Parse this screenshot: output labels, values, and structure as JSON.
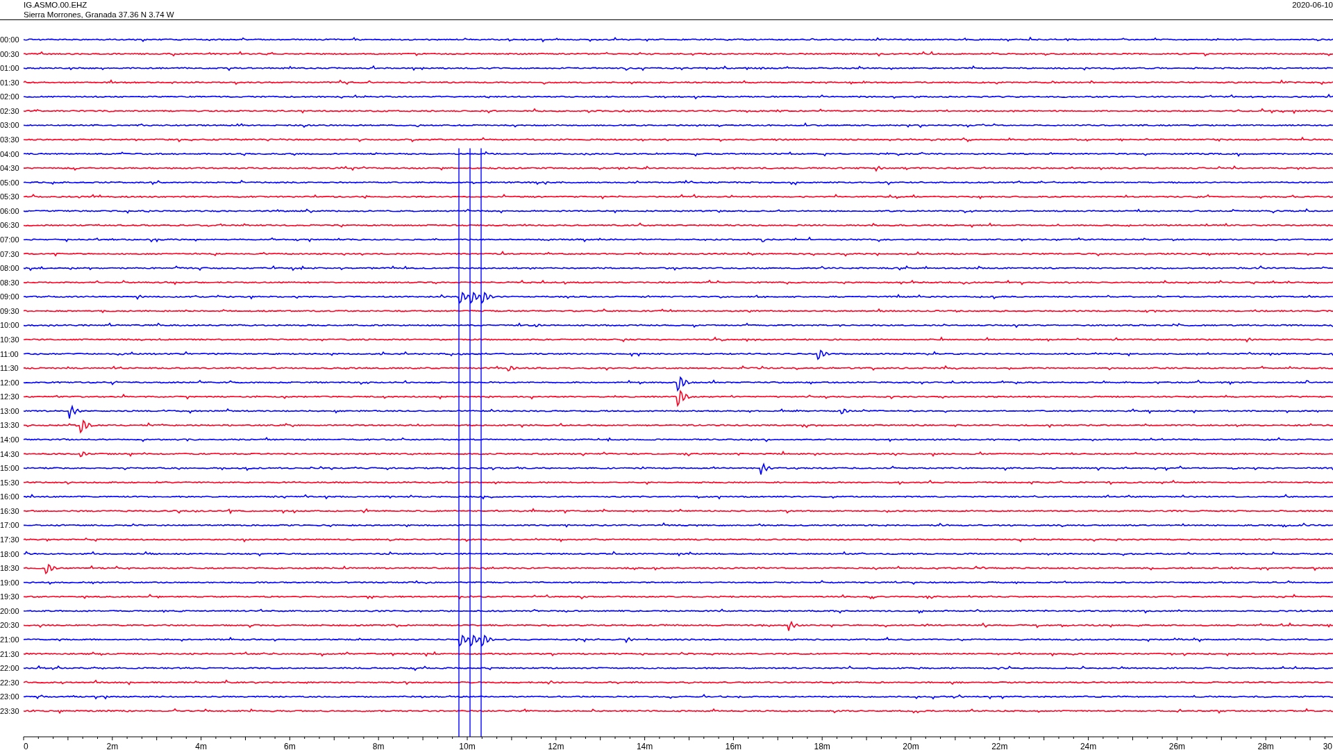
{
  "header": {
    "station": "IG.ASMO.00.EHZ",
    "location": "Sierra Morrones, Granada  37.36 N 3.74 W",
    "date": "2020-06-10"
  },
  "rows": [
    {
      "label": "00:00",
      "color": "#0000ff"
    },
    {
      "label": "00:30",
      "color": "#ff0022"
    },
    {
      "label": "01:00",
      "color": "#0000ff"
    },
    {
      "label": "01:30",
      "color": "#ff0022"
    },
    {
      "label": "02:00",
      "color": "#0000ff"
    },
    {
      "label": "02:30",
      "color": "#ff0022"
    },
    {
      "label": "03:00",
      "color": "#0000ff"
    },
    {
      "label": "03:30",
      "color": "#ff0022"
    },
    {
      "label": "04:00",
      "color": "#0000ff"
    },
    {
      "label": "04:30",
      "color": "#ff0022"
    },
    {
      "label": "05:00",
      "color": "#0000ff"
    },
    {
      "label": "05:30",
      "color": "#ff0022"
    },
    {
      "label": "06:00",
      "color": "#0000ff"
    },
    {
      "label": "06:30",
      "color": "#ff0022"
    },
    {
      "label": "07:00",
      "color": "#0000ff"
    },
    {
      "label": "07:30",
      "color": "#ff0022"
    },
    {
      "label": "08:00",
      "color": "#0000ff"
    },
    {
      "label": "08:30",
      "color": "#ff0022"
    },
    {
      "label": "09:00",
      "color": "#0000ff"
    },
    {
      "label": "09:30",
      "color": "#ff0022"
    },
    {
      "label": "10:00",
      "color": "#0000ff"
    },
    {
      "label": "10:30",
      "color": "#ff0022"
    },
    {
      "label": "11:00",
      "color": "#0000ff"
    },
    {
      "label": "11:30",
      "color": "#ff0022"
    },
    {
      "label": "12:00",
      "color": "#0000ff"
    },
    {
      "label": "12:30",
      "color": "#ff0022"
    },
    {
      "label": "13:00",
      "color": "#0000ff"
    },
    {
      "label": "13:30",
      "color": "#ff0022"
    },
    {
      "label": "14:00",
      "color": "#0000ff"
    },
    {
      "label": "14:30",
      "color": "#ff0022"
    },
    {
      "label": "15:00",
      "color": "#0000ff"
    },
    {
      "label": "15:30",
      "color": "#ff0022"
    },
    {
      "label": "16:00",
      "color": "#0000ff"
    },
    {
      "label": "16:30",
      "color": "#ff0022"
    },
    {
      "label": "17:00",
      "color": "#0000ff"
    },
    {
      "label": "17:30",
      "color": "#ff0022"
    },
    {
      "label": "18:00",
      "color": "#0000ff"
    },
    {
      "label": "18:30",
      "color": "#ff0022"
    },
    {
      "label": "19:00",
      "color": "#0000ff"
    },
    {
      "label": "19:30",
      "color": "#ff0022"
    },
    {
      "label": "20:00",
      "color": "#0000ff"
    },
    {
      "label": "20:30",
      "color": "#ff0022"
    },
    {
      "label": "21:00",
      "color": "#0000ff"
    },
    {
      "label": "21:30",
      "color": "#ff0022"
    },
    {
      "label": "22:00",
      "color": "#0000ff"
    },
    {
      "label": "22:30",
      "color": "#ff0022"
    },
    {
      "label": "23:00",
      "color": "#0000ff"
    },
    {
      "label": "23:30",
      "color": "#ff0022"
    }
  ],
  "x_axis": {
    "ticks": [
      "0",
      "2m",
      "4m",
      "6m",
      "8m",
      "10m",
      "12m",
      "14m",
      "16m",
      "18m",
      "20m",
      "22m",
      "24m",
      "26m",
      "28m",
      "30"
    ]
  }
}
